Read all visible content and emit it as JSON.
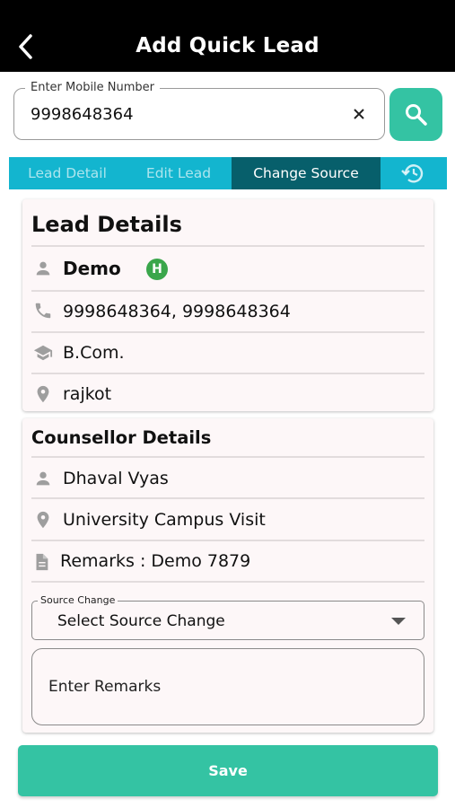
{
  "header": {
    "title": "Add Quick Lead",
    "back_icon": "back-arrow-icon"
  },
  "mobile": {
    "label": "Enter Mobile Number",
    "value": "9998648364"
  },
  "tabs": [
    {
      "label": "Lead Detail"
    },
    {
      "label": "Edit Lead"
    },
    {
      "label": "Change Source",
      "active": true
    },
    {
      "icon": "history-icon"
    }
  ],
  "lead_details": {
    "title": "Lead Details",
    "name": "Demo",
    "badge": "H",
    "phones": "9998648364, 9998648364",
    "education": "B.Com.",
    "city": "rajkot"
  },
  "counsellor_details": {
    "title": "Counsellor Details",
    "name": "Dhaval Vyas",
    "location": "University Campus Visit",
    "remarks": "Remarks : Demo 7879"
  },
  "source_change": {
    "label": "Source Change",
    "value": "Select Source Change"
  },
  "remarks_input": {
    "placeholder": "Enter Remarks"
  },
  "save_label": "Save",
  "colors": {
    "accent": "#34c3a3",
    "tab_bar": "#13b5cf",
    "tab_active": "#075f6b",
    "badge": "#3aa64b"
  }
}
